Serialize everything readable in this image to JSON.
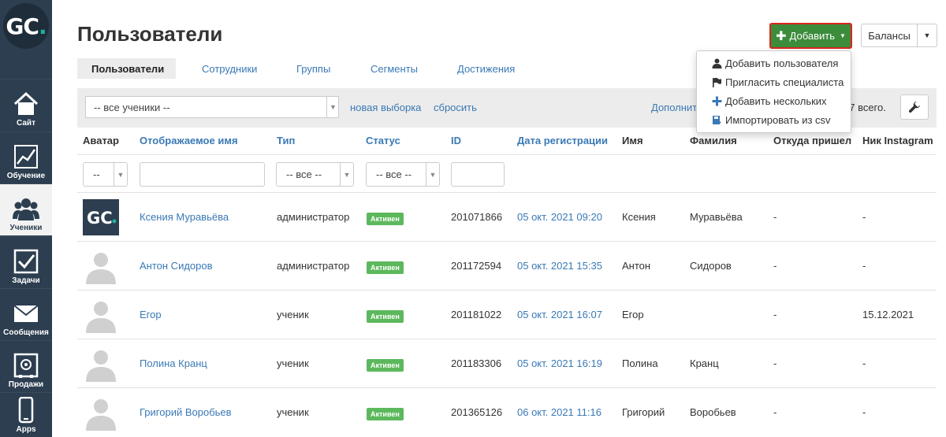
{
  "sidebar": {
    "logo": "GC",
    "logo_dot": ".",
    "items": [
      {
        "label": "Сайт",
        "icon": "home-icon"
      },
      {
        "label": "Обучение",
        "icon": "chart-icon"
      },
      {
        "label": "Ученики",
        "icon": "users-icon"
      },
      {
        "label": "Задачи",
        "icon": "checkbox-icon"
      },
      {
        "label": "Сообщения",
        "icon": "envelope-icon"
      },
      {
        "label": "Продажи",
        "icon": "safe-icon"
      },
      {
        "label": "Apps",
        "icon": "phone-icon"
      }
    ]
  },
  "header": {
    "title": "Пользователи",
    "add_label": "Добавить",
    "balance_label": "Балансы"
  },
  "tabs": [
    "Пользователи",
    "Сотрудники",
    "Группы",
    "Сегменты",
    "Достижения"
  ],
  "filter": {
    "select_value": "-- все ученики --",
    "new_selection": "новая выборка",
    "reset": "сбросить",
    "additional": "Дополнит",
    "total": "97 всего."
  },
  "dropdown": [
    {
      "label": "Добавить пользователя",
      "icon": "user-icon"
    },
    {
      "label": "Пригласить специалиста",
      "icon": "flag-icon"
    },
    {
      "label": "Добавить нескольких",
      "icon": "plus-icon"
    },
    {
      "label": "Импортировать из csv",
      "icon": "import-icon"
    }
  ],
  "table": {
    "headers": [
      "Аватар",
      "Отображаемое имя",
      "Тип",
      "Статус",
      "ID",
      "Дата регистрации",
      "Имя",
      "Фамилия",
      "Откуда пришел",
      "Ник Instagram"
    ],
    "filter_all": "-- все --",
    "filter_dash": "--",
    "rows": [
      {
        "name": "Ксения Муравьёва",
        "type": "администратор",
        "status": "Активен",
        "id": "201071866",
        "date": "05 окт. 2021 09:20",
        "first": "Ксения",
        "last": "Муравьёва",
        "from": "-",
        "insta": "-",
        "avatar": "logo"
      },
      {
        "name": "Антон Сидоров",
        "type": "администратор",
        "status": "Активен",
        "id": "201172594",
        "date": "05 окт. 2021 15:35",
        "first": "Антон",
        "last": "Сидоров",
        "from": "-",
        "insta": "-",
        "avatar": "person"
      },
      {
        "name": "Егор",
        "type": "ученик",
        "status": "Активен",
        "id": "201181022",
        "date": "05 окт. 2021 16:07",
        "first": "Егор",
        "last": "",
        "from": "-",
        "insta": "15.12.2021",
        "avatar": "person"
      },
      {
        "name": "Полина Кранц",
        "type": "ученик",
        "status": "Активен",
        "id": "201183306",
        "date": "05 окт. 2021 16:19",
        "first": "Полина",
        "last": "Кранц",
        "from": "-",
        "insta": "-",
        "avatar": "person"
      },
      {
        "name": "Григорий Воробьев",
        "type": "ученик",
        "status": "Активен",
        "id": "201365126",
        "date": "06 окт. 2021 11:16",
        "first": "Григорий",
        "last": "Воробьев",
        "from": "-",
        "insta": "-",
        "avatar": "person"
      }
    ]
  },
  "colors": {
    "sidebar": "#2c3e50",
    "add_button": "#3c8c3c",
    "add_border": "#d9261c",
    "link": "#3a79b5",
    "badge": "#5cb85c"
  }
}
